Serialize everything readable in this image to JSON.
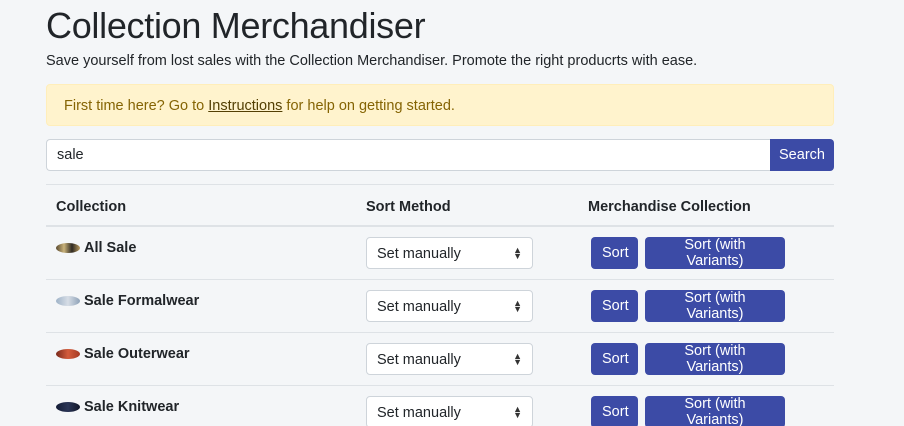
{
  "header": {
    "title": "Collection Merchandiser",
    "subtitle": "Save yourself from lost sales with the Collection Merchandiser. Promote the right producrts with ease."
  },
  "notice": {
    "prefix": "First time here? Go to ",
    "link": "Instructions",
    "suffix": " for help on getting started."
  },
  "search": {
    "value": "sale",
    "button_label": "Search"
  },
  "table": {
    "columns": [
      "Collection",
      "Sort Method",
      "Merchandise Collection"
    ],
    "rows": [
      {
        "name": "All Sale",
        "sort_method": "Set manually",
        "sort_label": "Sort",
        "variants_label": "Sort (with Variants)"
      },
      {
        "name": "Sale Formalwear",
        "sort_method": "Set manually",
        "sort_label": "Sort",
        "variants_label": "Sort (with Variants)"
      },
      {
        "name": "Sale Outerwear",
        "sort_method": "Set manually",
        "sort_label": "Sort",
        "variants_label": "Sort (with Variants)"
      },
      {
        "name": "Sale Knitwear",
        "sort_method": "Set manually",
        "sort_label": "Sort",
        "variants_label": "Sort (with Variants)"
      }
    ]
  },
  "colors": {
    "primary": "#3c4ba6",
    "alert_bg": "#fff3cd",
    "alert_text": "#856404"
  }
}
